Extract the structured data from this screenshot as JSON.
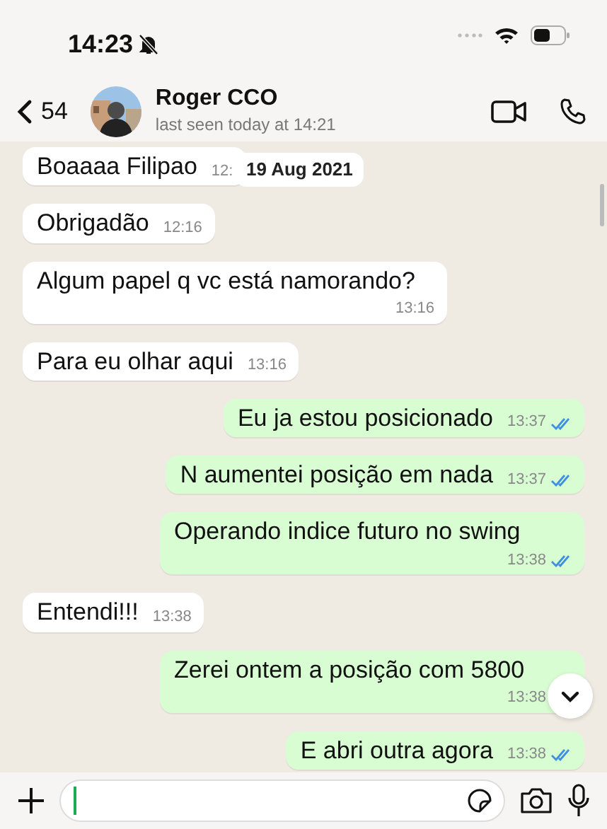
{
  "status_bar": {
    "time": "14:23",
    "muted": true
  },
  "header": {
    "back_count": "54",
    "name": "Roger CCO",
    "last_seen": "last seen today at 14:21"
  },
  "date_chip": "19 Aug 2021",
  "messages": [
    {
      "kind": "incoming",
      "text": "Boaaaa Filipao",
      "time": "12:"
    },
    {
      "kind": "incoming",
      "text": "Obrigadão",
      "time": "12:16"
    },
    {
      "kind": "incoming",
      "text": "Algum papel q vc está namorando?",
      "time": "13:16"
    },
    {
      "kind": "incoming",
      "text": "Para eu olhar aqui",
      "time": "13:16"
    },
    {
      "kind": "outgoing",
      "text": "Eu ja estou posicionado",
      "time": "13:37",
      "read": true
    },
    {
      "kind": "outgoing",
      "text": "N aumentei posição em nada",
      "time": "13:37",
      "read": true
    },
    {
      "kind": "outgoing",
      "text": "Operando indice futuro no swing",
      "time": "13:38",
      "read": true
    },
    {
      "kind": "incoming",
      "text": "Entendi!!!",
      "time": "13:38"
    },
    {
      "kind": "outgoing",
      "text": "Zerei ontem a posição com 5800",
      "time": "13:38"
    },
    {
      "kind": "outgoing",
      "text": "E abri outra agora",
      "time": "13:38",
      "read": true
    }
  ]
}
